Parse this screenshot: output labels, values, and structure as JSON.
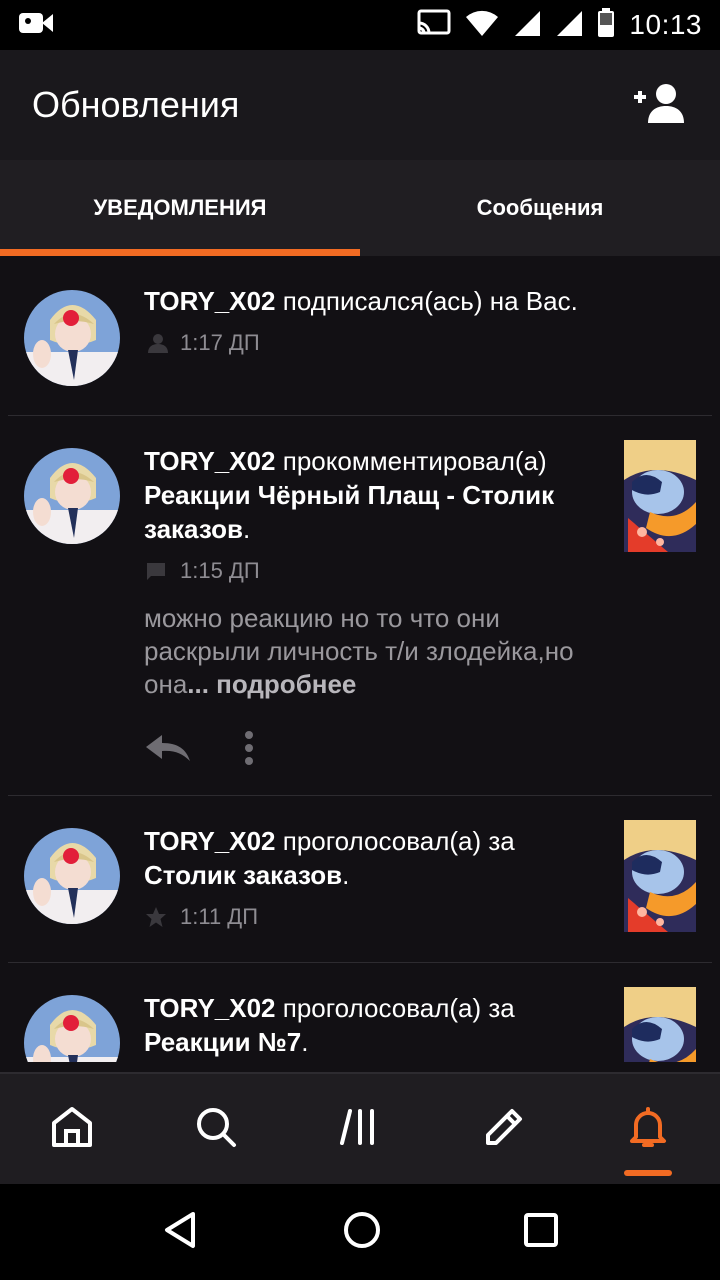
{
  "status_bar": {
    "time": "10:13",
    "icons": [
      "video-camera-icon",
      "cast-icon",
      "wifi-icon",
      "signal-icon",
      "signal-icon",
      "battery-icon"
    ]
  },
  "app_bar": {
    "title": "Обновления",
    "action_icon": "add-user-icon"
  },
  "tabs": [
    {
      "label": "УВЕДОМЛЕНИЯ",
      "active": true
    },
    {
      "label": "Сообщения",
      "active": false
    }
  ],
  "notifications": [
    {
      "user": "TORY_X02",
      "action": " подписался(ась) на Вас.",
      "target": "",
      "time": "1:17 ДП",
      "type_icon": "follower-icon"
    },
    {
      "user": "TORY_X02",
      "action": " прокомментировал(а) ",
      "target": "Реакции Чёрный Плащ - Столик заказов",
      "suffix": ".",
      "time": "1:15 ДП",
      "type_icon": "comment-icon",
      "comment": "можно реакцию но то что они раскрыли личность т/и злодейка,но она",
      "ellipsis": "...",
      "more": " подробнее"
    },
    {
      "user": "TORY_X02",
      "action": " проголосовал(а) за ",
      "target": "Столик заказов",
      "suffix": ".",
      "time": "1:11 ДП",
      "type_icon": "star-icon"
    },
    {
      "user": "TORY_X02",
      "action": " проголосовал(а) за ",
      "target": "Реакции №7",
      "suffix": "."
    }
  ],
  "bottom_nav": [
    "home-icon",
    "search-icon",
    "library-icon",
    "write-icon",
    "notifications-icon"
  ],
  "colors": {
    "accent": "#f26b23",
    "background": "#121014",
    "app_bar": "#1a181c",
    "tabs": "#201e22"
  }
}
